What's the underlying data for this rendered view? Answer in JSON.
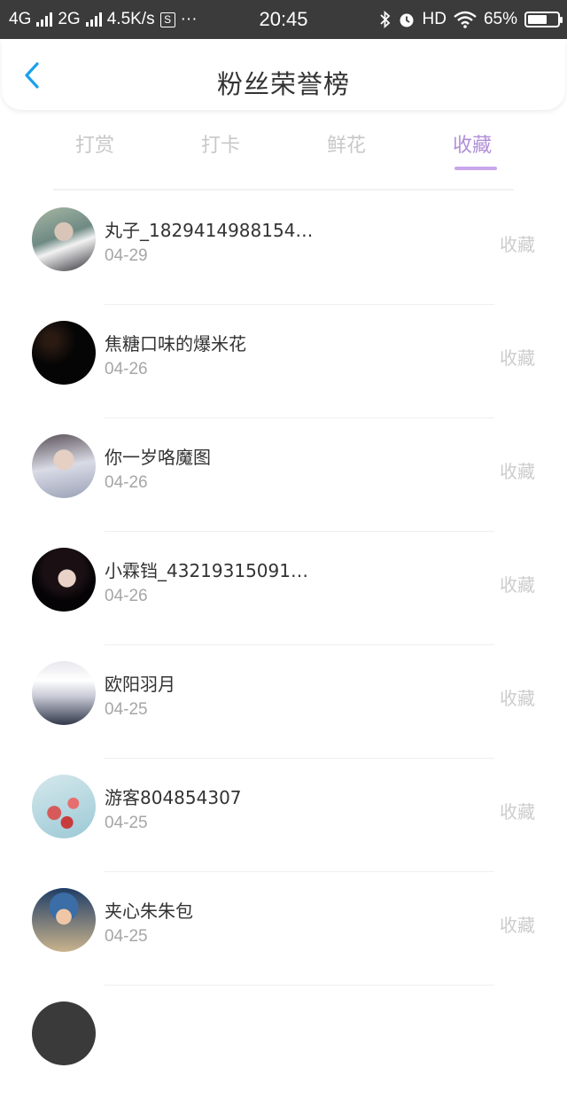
{
  "status_bar": {
    "network1": "4G",
    "network2": "2G",
    "speed": "4.5K/s",
    "s_icon": "S",
    "dots": "···",
    "time": "20:45",
    "hd": "HD",
    "battery_percent": "65%",
    "battery_level": 0.65
  },
  "header": {
    "title": "粉丝荣誉榜"
  },
  "tabs": {
    "items": [
      "打赏",
      "打卡",
      "鲜花",
      "收藏"
    ],
    "active_index": 3
  },
  "colors": {
    "accent": "#b28fd8",
    "tab_underline": "#c9a6ea",
    "back_icon": "#1aa0f0"
  },
  "fans": [
    {
      "name": "丸子_1829414988154…",
      "date": "04-29",
      "action": "收藏"
    },
    {
      "name": "焦糖口味的爆米花",
      "date": "04-26",
      "action": "收藏"
    },
    {
      "name": "你一岁咯魔图",
      "date": "04-26",
      "action": "收藏"
    },
    {
      "name": "小霖铛_43219315091…",
      "date": "04-26",
      "action": "收藏"
    },
    {
      "name": "欧阳羽月",
      "date": "04-25",
      "action": "收藏"
    },
    {
      "name": "游客804854307",
      "date": "04-25",
      "action": "收藏"
    },
    {
      "name": "夹心朱朱包",
      "date": "04-25",
      "action": "收藏"
    }
  ]
}
